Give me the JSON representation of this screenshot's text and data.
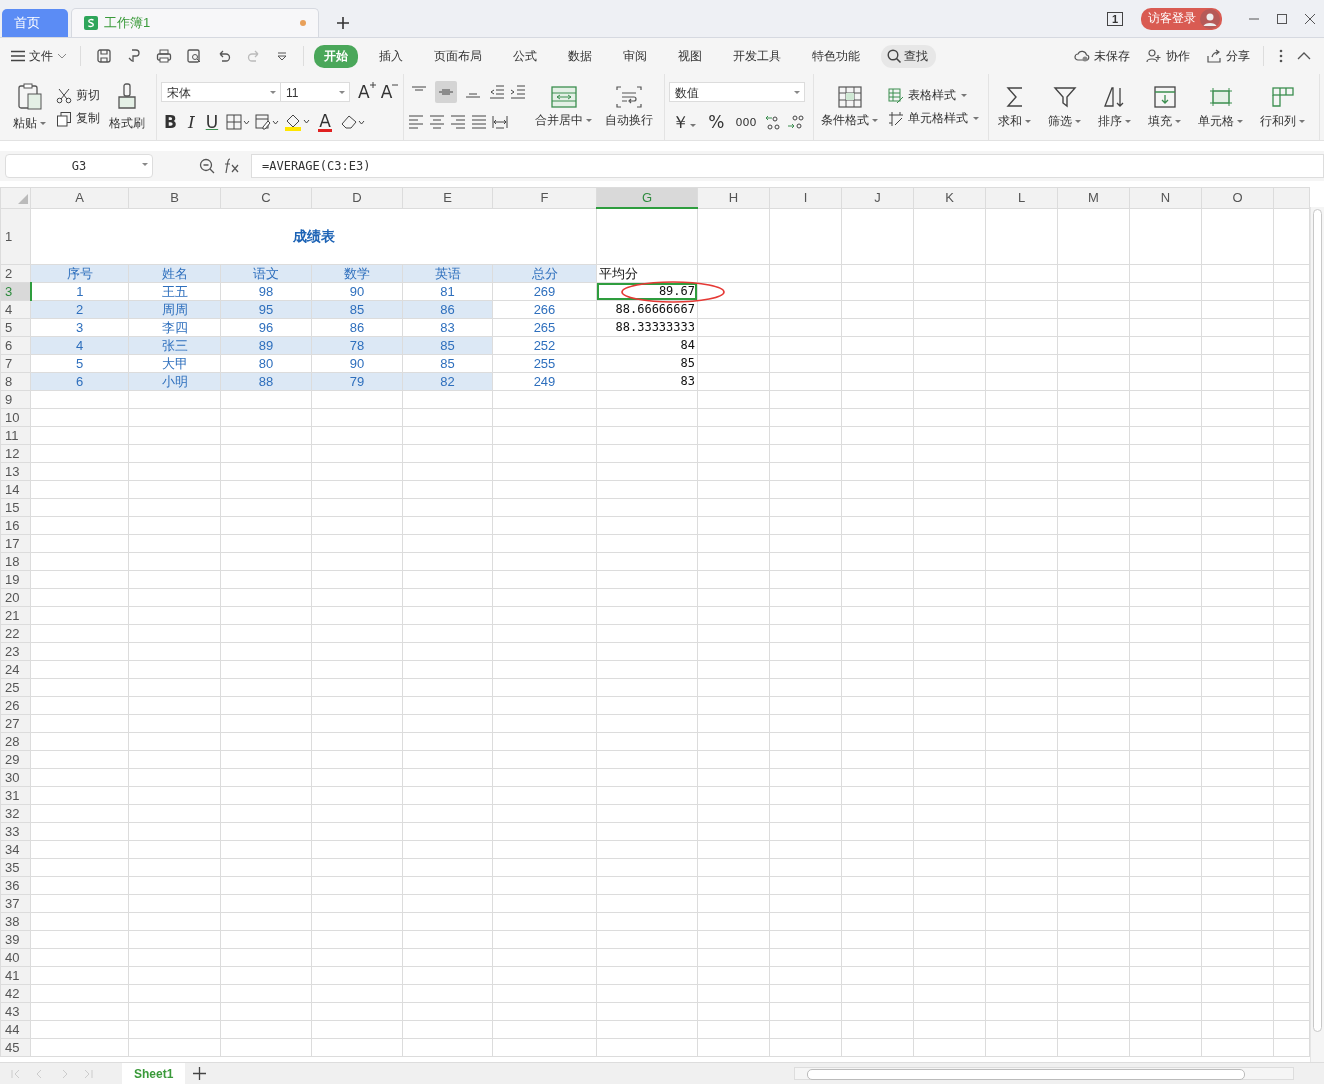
{
  "tabs": [
    {
      "label": "首页",
      "kind": "home",
      "selected": false,
      "modified": false
    },
    {
      "label": "工作簿1",
      "kind": "sheet",
      "selected": true,
      "modified": true
    }
  ],
  "page_indicator": "1",
  "account": {
    "label": "访客登录"
  },
  "menu": {
    "file": "文件",
    "search": "查找",
    "actions": [
      "未保存",
      "协作",
      "分享"
    ],
    "tabs": [
      {
        "label": "开始",
        "selected": true
      },
      {
        "label": "插入",
        "selected": false
      },
      {
        "label": "页面布局",
        "selected": false
      },
      {
        "label": "公式",
        "selected": false
      },
      {
        "label": "数据",
        "selected": false
      },
      {
        "label": "审阅",
        "selected": false
      },
      {
        "label": "视图",
        "selected": false
      },
      {
        "label": "开发工具",
        "selected": false
      },
      {
        "label": "特色功能",
        "selected": false
      }
    ]
  },
  "ribbon": {
    "paste": "粘贴",
    "cut": "剪切",
    "copy": "复制",
    "format_painter": "格式刷",
    "font_name": "宋体",
    "font_size": "11",
    "grow_font": "A",
    "shrink_font": "A",
    "styles": [
      "B",
      "I",
      "U"
    ],
    "font_color": "A",
    "vertical_align": [
      {
        "selected": false
      },
      {
        "selected": true
      },
      {
        "selected": false
      }
    ],
    "merge": "合并居中",
    "wrap": "自动换行",
    "number_format": "数值",
    "currency": "￥",
    "percent": "%",
    "thousands": "000",
    "conditional": "条件格式",
    "table_style": "表格样式",
    "cell_style": "单元格样式",
    "tools": [
      "求和",
      "筛选",
      "排序",
      "填充",
      "单元格",
      "行和列"
    ]
  },
  "formula_bar": {
    "name_box": "G3",
    "formula": "=AVERAGE(C3:E3)"
  },
  "sheet": {
    "columns": [
      {
        "label": "A",
        "selected": false
      },
      {
        "label": "B",
        "selected": false
      },
      {
        "label": "C",
        "selected": false
      },
      {
        "label": "D",
        "selected": false
      },
      {
        "label": "E",
        "selected": false
      },
      {
        "label": "F",
        "selected": false
      },
      {
        "label": "G",
        "selected": true
      },
      {
        "label": "H",
        "selected": false
      },
      {
        "label": "I",
        "selected": false
      },
      {
        "label": "J",
        "selected": false
      },
      {
        "label": "K",
        "selected": false
      },
      {
        "label": "L",
        "selected": false
      },
      {
        "label": "M",
        "selected": false
      },
      {
        "label": "N",
        "selected": false
      },
      {
        "label": "O",
        "selected": false
      }
    ],
    "rows": [
      {
        "number": "1",
        "kind": "title",
        "selected": false,
        "title": "成绩表"
      },
      {
        "number": "2",
        "kind": "header",
        "selected": false,
        "values": [
          "序号",
          "姓名",
          "语文",
          "数学",
          "英语",
          "总分"
        ],
        "average": "平均分"
      },
      {
        "number": "3",
        "kind": "data",
        "selected": true,
        "banded": false,
        "circled": true,
        "values": [
          "1",
          "王五",
          "98",
          "90",
          "81",
          "269"
        ],
        "average": "89.67"
      },
      {
        "number": "4",
        "kind": "data",
        "selected": false,
        "banded": true,
        "circled": false,
        "values": [
          "2",
          "周周",
          "95",
          "85",
          "86",
          "266"
        ],
        "average": "88.66666667"
      },
      {
        "number": "5",
        "kind": "data",
        "selected": false,
        "banded": false,
        "circled": false,
        "values": [
          "3",
          "李四",
          "96",
          "86",
          "83",
          "265"
        ],
        "average": "88.33333333"
      },
      {
        "number": "6",
        "kind": "data",
        "selected": false,
        "banded": true,
        "circled": false,
        "values": [
          "4",
          "张三",
          "89",
          "78",
          "85",
          "252"
        ],
        "average": "84"
      },
      {
        "number": "7",
        "kind": "data",
        "selected": false,
        "banded": false,
        "circled": false,
        "values": [
          "5",
          "大甲",
          "80",
          "90",
          "85",
          "255"
        ],
        "average": "85"
      },
      {
        "number": "8",
        "kind": "data",
        "selected": false,
        "banded": true,
        "circled": false,
        "values": [
          "6",
          "小明",
          "88",
          "79",
          "82",
          "249"
        ],
        "average": "83"
      },
      {
        "number": "9",
        "kind": "empty",
        "selected": false
      },
      {
        "number": "10",
        "kind": "empty",
        "selected": false
      },
      {
        "number": "11",
        "kind": "empty",
        "selected": false
      },
      {
        "number": "12",
        "kind": "empty",
        "selected": false
      },
      {
        "number": "13",
        "kind": "empty",
        "selected": false
      },
      {
        "number": "14",
        "kind": "empty",
        "selected": false
      },
      {
        "number": "15",
        "kind": "empty",
        "selected": false
      },
      {
        "number": "16",
        "kind": "empty",
        "selected": false
      },
      {
        "number": "17",
        "kind": "empty",
        "selected": false
      },
      {
        "number": "18",
        "kind": "empty",
        "selected": false
      },
      {
        "number": "19",
        "kind": "empty",
        "selected": false
      },
      {
        "number": "20",
        "kind": "empty",
        "selected": false
      },
      {
        "number": "21",
        "kind": "empty",
        "selected": false
      },
      {
        "number": "22",
        "kind": "empty",
        "selected": false
      },
      {
        "number": "23",
        "kind": "empty",
        "selected": false
      },
      {
        "number": "24",
        "kind": "empty",
        "selected": false
      },
      {
        "number": "25",
        "kind": "empty",
        "selected": false
      },
      {
        "number": "26",
        "kind": "empty",
        "selected": false
      },
      {
        "number": "27",
        "kind": "empty",
        "selected": false
      },
      {
        "number": "28",
        "kind": "empty",
        "selected": false
      },
      {
        "number": "29",
        "kind": "empty",
        "selected": false
      },
      {
        "number": "30",
        "kind": "empty",
        "selected": false
      },
      {
        "number": "31",
        "kind": "empty",
        "selected": false
      },
      {
        "number": "32",
        "kind": "empty",
        "selected": false
      },
      {
        "number": "33",
        "kind": "empty",
        "selected": false
      },
      {
        "number": "34",
        "kind": "empty",
        "selected": false
      },
      {
        "number": "35",
        "kind": "empty",
        "selected": false
      },
      {
        "number": "36",
        "kind": "empty",
        "selected": false
      },
      {
        "number": "37",
        "kind": "empty",
        "selected": false
      },
      {
        "number": "38",
        "kind": "empty",
        "selected": false
      },
      {
        "number": "39",
        "kind": "empty",
        "selected": false
      },
      {
        "number": "40",
        "kind": "empty",
        "selected": false
      },
      {
        "number": "41",
        "kind": "empty",
        "selected": false
      },
      {
        "number": "42",
        "kind": "empty",
        "selected": false
      },
      {
        "number": "43",
        "kind": "empty",
        "selected": false
      },
      {
        "number": "44",
        "kind": "empty",
        "selected": false
      },
      {
        "number": "45",
        "kind": "empty",
        "selected": false
      }
    ]
  },
  "sheet_tabs": [
    {
      "label": "Sheet1",
      "selected": true
    }
  ]
}
